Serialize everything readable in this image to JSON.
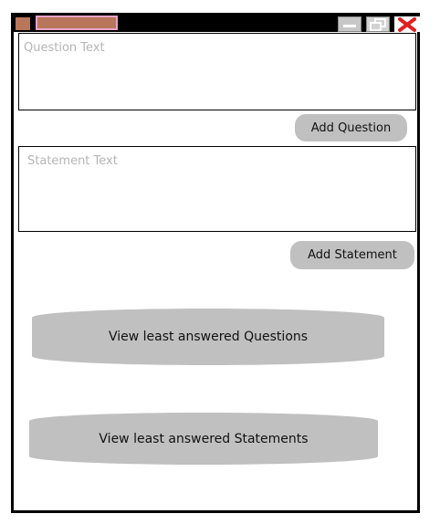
{
  "question": {
    "placeholder": "Question Text",
    "value": ""
  },
  "buttons": {
    "add_question": "Add Question",
    "add_statement": "Add Statement",
    "view_questions": "View least answered Questions",
    "view_statements": "View least answered Statements"
  },
  "statement": {
    "placeholder": "Statement Text",
    "value": ""
  },
  "icons": {
    "app": "app-icon",
    "minimize": "minimize-icon",
    "maximize": "restore-icon",
    "close": "close-icon"
  },
  "colors": {
    "title_bar": "#000000",
    "app_icon": "#b8765a",
    "title_tab_border": "#e7a3c8",
    "button_fill": "#c0c0c0",
    "close_x": "#e02020",
    "placeholder": "#b5b5b5"
  }
}
